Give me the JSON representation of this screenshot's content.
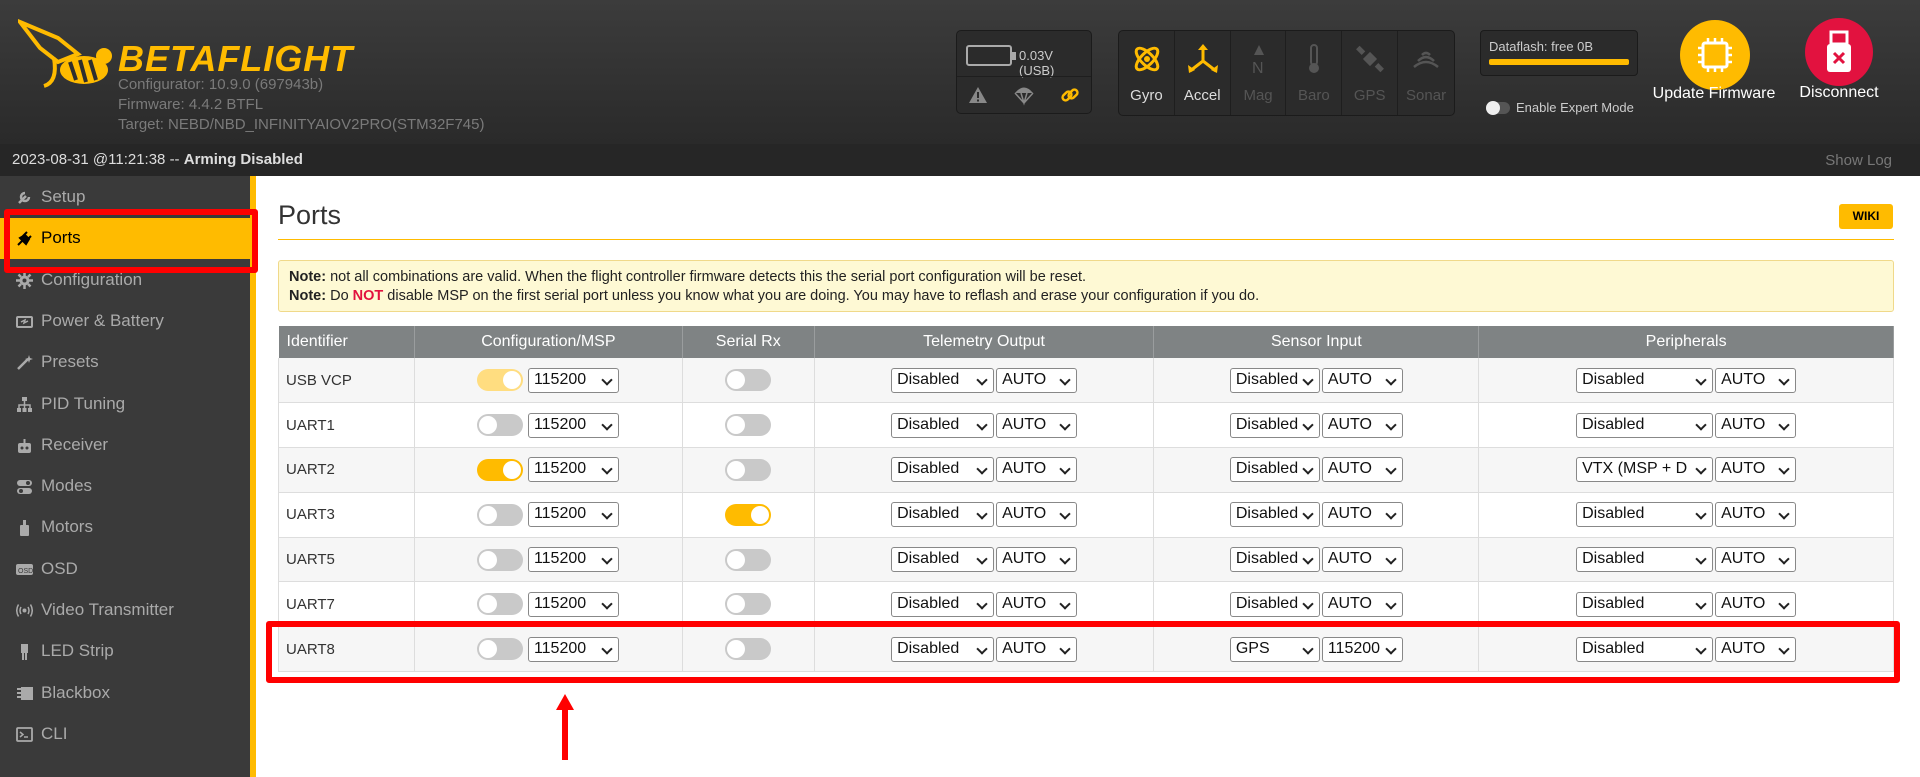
{
  "header": {
    "brand": "BETAFLIGHT",
    "configurator": "Configurator: 10.9.0 (697943b)",
    "firmware": "Firmware: 4.4.2 BTFL",
    "target": "Target: NEBD/NBD_INFINITYAIOV2PRO(STM32F745)",
    "battery_voltage": "0.03V (USB)",
    "sensors": [
      {
        "label": "Gyro",
        "icon": "gyro-icon",
        "active": true
      },
      {
        "label": "Accel",
        "icon": "accel-icon",
        "active": true
      },
      {
        "label": "Mag",
        "icon": "mag-icon",
        "active": false
      },
      {
        "label": "Baro",
        "icon": "baro-icon",
        "active": false
      },
      {
        "label": "GPS",
        "icon": "gps-icon",
        "active": false
      },
      {
        "label": "Sonar",
        "icon": "sonar-icon",
        "active": false
      }
    ],
    "dataflash": "Dataflash: free 0B",
    "expert_mode_label": "Enable Expert Mode",
    "update_firmware": "Update Firmware",
    "disconnect": "Disconnect"
  },
  "status": {
    "datetime": "2023-08-31 @11:21:38 -- ",
    "arming": "Arming Disabled",
    "show_log": "Show Log"
  },
  "sidebar": {
    "items": [
      {
        "label": "Setup",
        "icon": "wrench-icon"
      },
      {
        "label": "Ports",
        "icon": "plug-icon",
        "active": true
      },
      {
        "label": "Configuration",
        "icon": "gear-icon"
      },
      {
        "label": "Power & Battery",
        "icon": "battery-icon"
      },
      {
        "label": "Presets",
        "icon": "magic-icon"
      },
      {
        "label": "PID Tuning",
        "icon": "sitemap-icon"
      },
      {
        "label": "Receiver",
        "icon": "robot-icon"
      },
      {
        "label": "Modes",
        "icon": "toggles-icon"
      },
      {
        "label": "Motors",
        "icon": "motor-icon"
      },
      {
        "label": "OSD",
        "icon": "osd-icon"
      },
      {
        "label": "Video Transmitter",
        "icon": "broadcast-icon"
      },
      {
        "label": "LED Strip",
        "icon": "led-icon"
      },
      {
        "label": "Blackbox",
        "icon": "blackbox-icon"
      },
      {
        "label": "CLI",
        "icon": "terminal-icon"
      }
    ]
  },
  "page": {
    "title": "Ports",
    "wiki": "WIKI",
    "note1_label": "Note:",
    "note1_text": " not all combinations are valid. When the flight controller firmware detects this the serial port configuration will be reset.",
    "note2_label": "Note:",
    "note2_pre": " Do ",
    "note2_not": "NOT",
    "note2_post": " disable MSP on the first serial port unless you know what you are doing. You may have to reflash and erase your configuration if you do."
  },
  "table": {
    "headers": [
      "Identifier",
      "Configuration/MSP",
      "Serial Rx",
      "Telemetry Output",
      "Sensor Input",
      "Peripherals"
    ],
    "rows": [
      {
        "id": "USB VCP",
        "msp": "faded",
        "msp_baud": "115200",
        "rx": false,
        "tel": "Disabled",
        "tel_baud": "AUTO",
        "sen": "Disabled",
        "sen_baud": "AUTO",
        "per": "Disabled",
        "per_baud": "AUTO"
      },
      {
        "id": "UART1",
        "msp": "off",
        "msp_baud": "115200",
        "rx": false,
        "tel": "Disabled",
        "tel_baud": "AUTO",
        "sen": "Disabled",
        "sen_baud": "AUTO",
        "per": "Disabled",
        "per_baud": "AUTO"
      },
      {
        "id": "UART2",
        "msp": "on",
        "msp_baud": "115200",
        "rx": false,
        "tel": "Disabled",
        "tel_baud": "AUTO",
        "sen": "Disabled",
        "sen_baud": "AUTO",
        "per": "VTX (MSP + D",
        "per_baud": "AUTO"
      },
      {
        "id": "UART3",
        "msp": "off",
        "msp_baud": "115200",
        "rx": true,
        "tel": "Disabled",
        "tel_baud": "AUTO",
        "sen": "Disabled",
        "sen_baud": "AUTO",
        "per": "Disabled",
        "per_baud": "AUTO"
      },
      {
        "id": "UART5",
        "msp": "off",
        "msp_baud": "115200",
        "rx": false,
        "tel": "Disabled",
        "tel_baud": "AUTO",
        "sen": "Disabled",
        "sen_baud": "AUTO",
        "per": "Disabled",
        "per_baud": "AUTO"
      },
      {
        "id": "UART7",
        "msp": "off",
        "msp_baud": "115200",
        "rx": false,
        "tel": "Disabled",
        "tel_baud": "AUTO",
        "sen": "Disabled",
        "sen_baud": "AUTO",
        "per": "Disabled",
        "per_baud": "AUTO"
      },
      {
        "id": "UART8",
        "msp": "off",
        "msp_baud": "115200",
        "rx": false,
        "tel": "Disabled",
        "tel_baud": "AUTO",
        "sen": "GPS",
        "sen_baud": "115200",
        "per": "Disabled",
        "per_baud": "AUTO"
      }
    ]
  },
  "colors": {
    "accent": "#ffbb00",
    "annotation": "#ff0000",
    "disconnect": "#e2123f"
  }
}
